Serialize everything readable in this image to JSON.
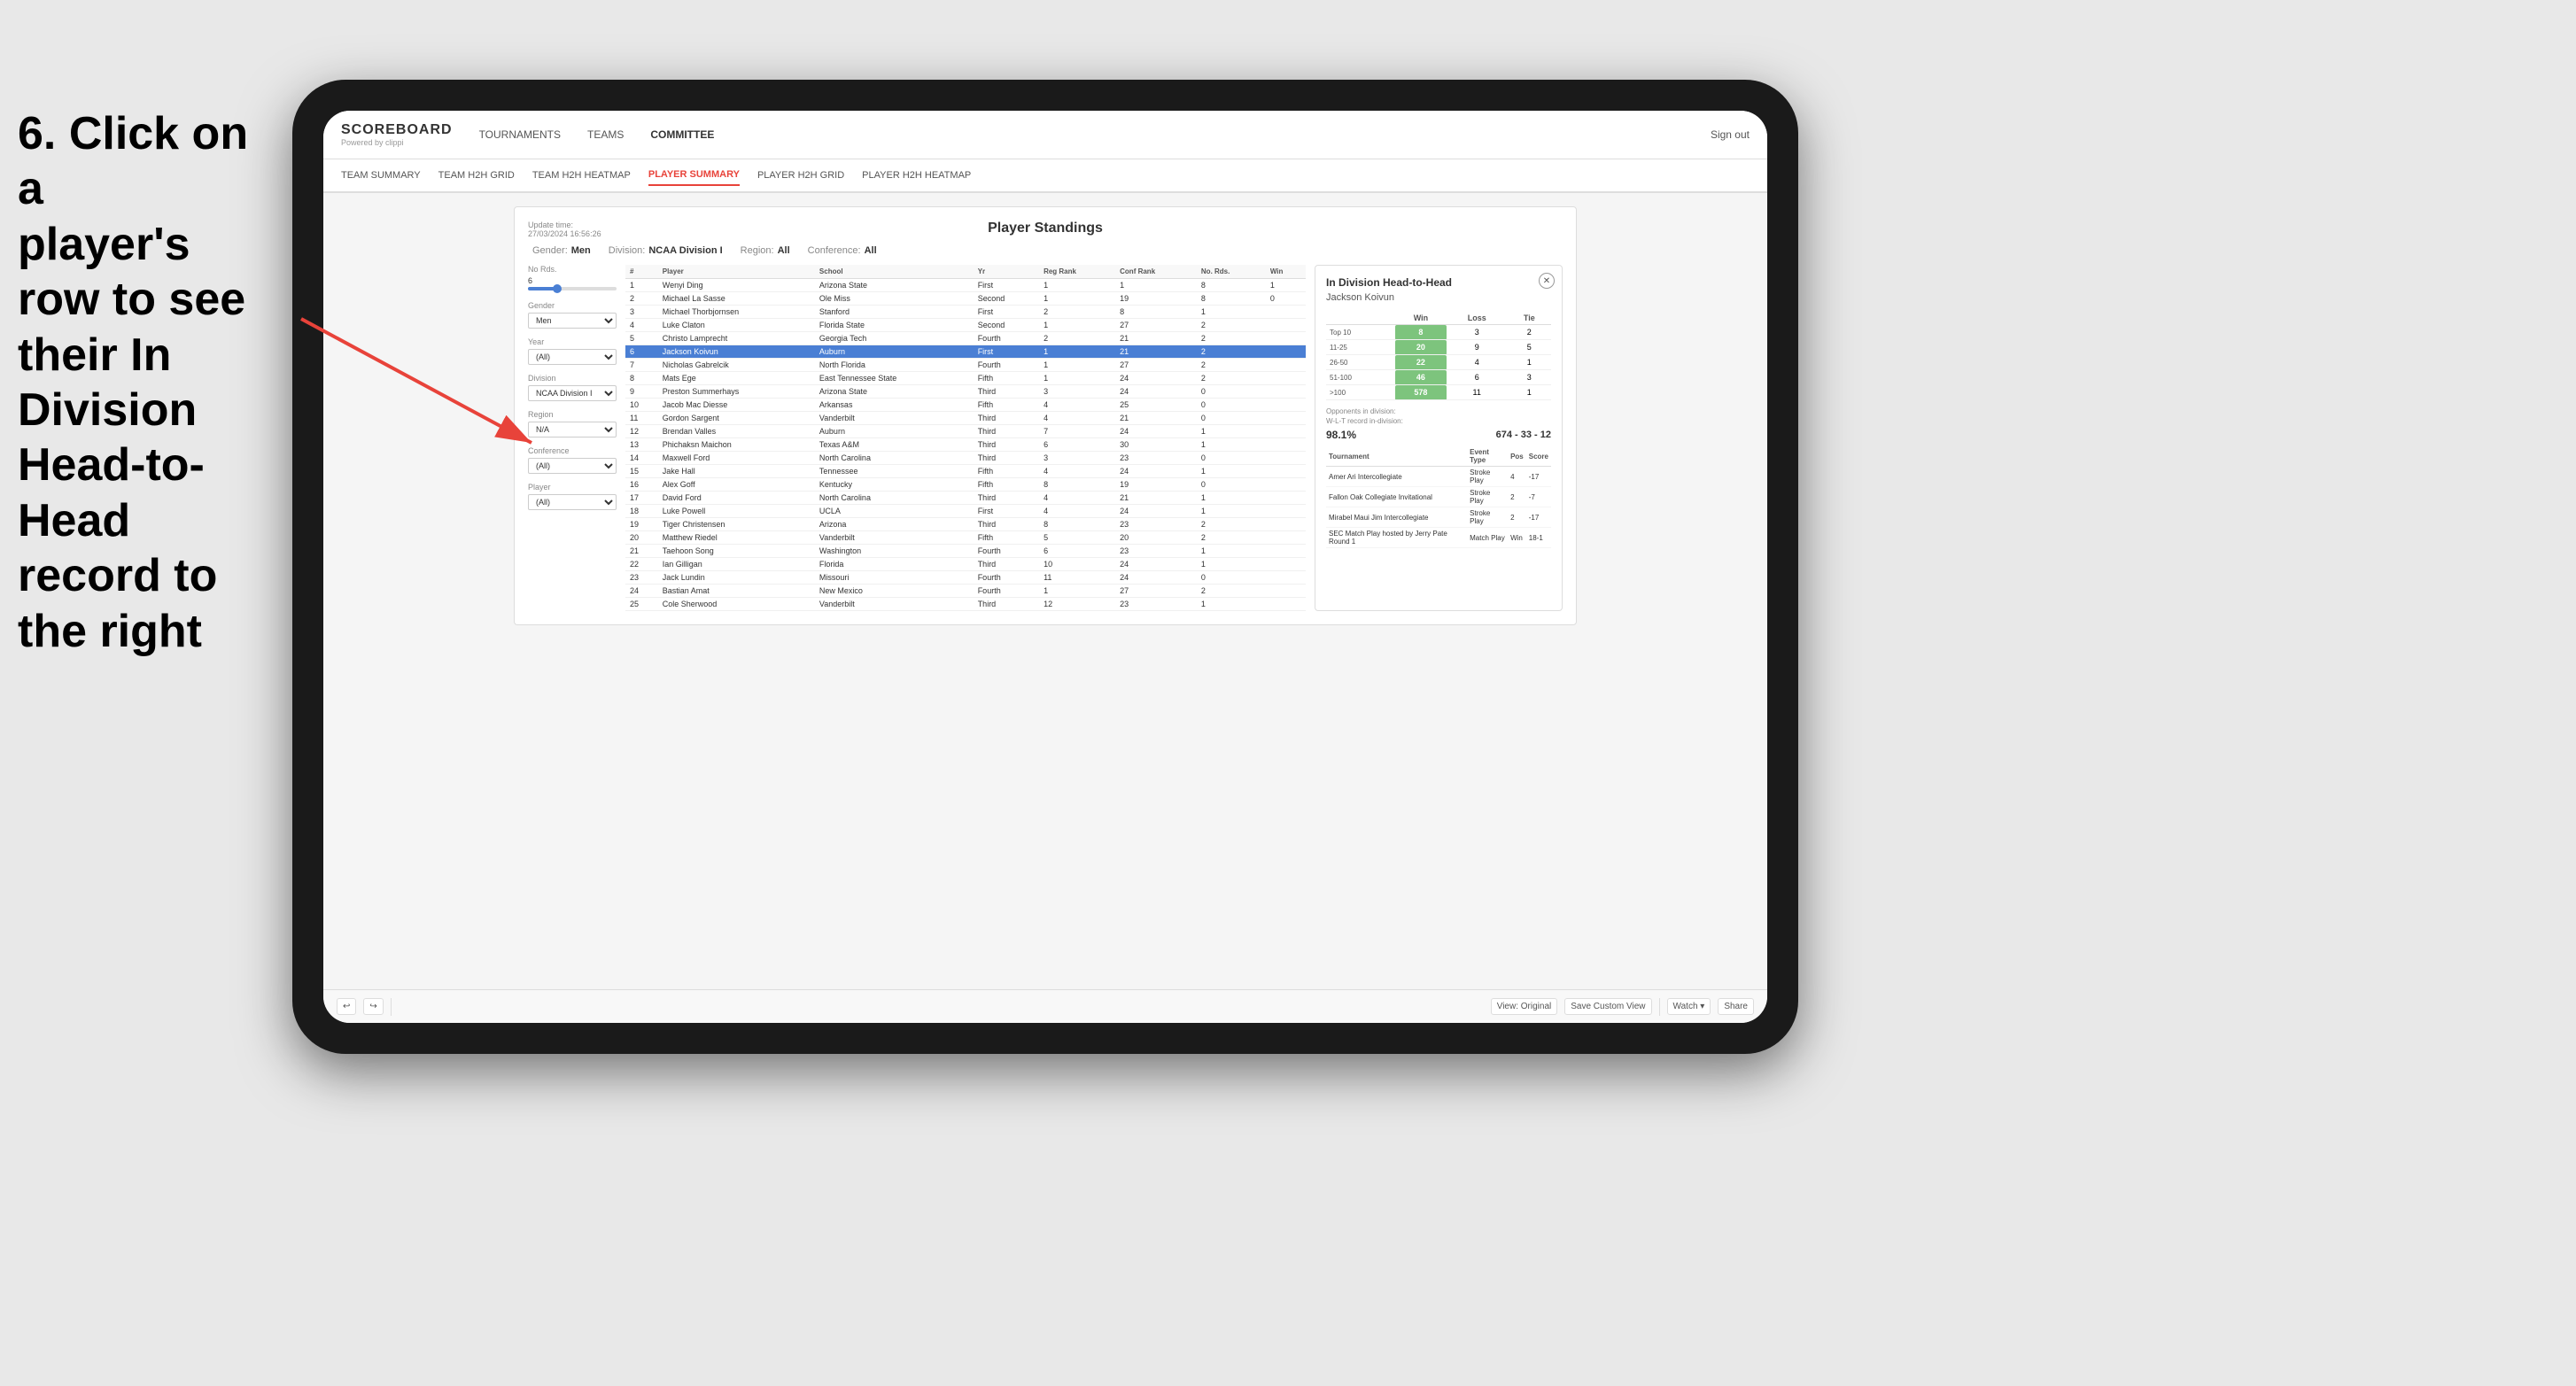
{
  "instruction": {
    "lines": [
      "6. Click on a",
      "player's row to see",
      "their In Division",
      "Head-to-Head",
      "record to the right"
    ]
  },
  "nav": {
    "logo": "SCOREBOARD",
    "powered_by": "Powered by clippi",
    "links": [
      "TOURNAMENTS",
      "TEAMS",
      "COMMITTEE"
    ],
    "sign_out": "Sign out"
  },
  "sub_nav": {
    "links": [
      "TEAM SUMMARY",
      "TEAM H2H GRID",
      "TEAM H2H HEATMAP",
      "PLAYER SUMMARY",
      "PLAYER H2H GRID",
      "PLAYER H2H HEATMAP"
    ],
    "active": "PLAYER SUMMARY"
  },
  "card": {
    "title": "Player Standings",
    "update_time": "Update time:",
    "update_date": "27/03/2024 16:56:26"
  },
  "filters": {
    "gender_label": "Gender:",
    "gender_value": "Men",
    "division_label": "Division:",
    "division_value": "NCAA Division I",
    "region_label": "Region:",
    "region_value": "All",
    "conference_label": "Conference:",
    "conference_value": "All"
  },
  "sidebar": {
    "no_rds_label": "No Rds.",
    "no_rds_value": "6",
    "gender_label": "Gender",
    "gender_option": "Men",
    "year_label": "Year",
    "year_option": "(All)",
    "division_label": "Division",
    "division_option": "NCAA Division I",
    "region_label": "Region",
    "region_option": "N/A",
    "conference_label": "Conference",
    "conference_option": "(All)",
    "player_label": "Player",
    "player_option": "(All)"
  },
  "table": {
    "headers": [
      "#",
      "Player",
      "School",
      "Yr",
      "Reg Rank",
      "Conf Rank",
      "No. Rds.",
      "Win"
    ],
    "rows": [
      {
        "num": 1,
        "player": "Wenyi Ding",
        "school": "Arizona State",
        "yr": "First",
        "reg": 1,
        "conf": 1,
        "rds": 8,
        "win": 1
      },
      {
        "num": 2,
        "player": "Michael La Sasse",
        "school": "Ole Miss",
        "yr": "Second",
        "reg": 1,
        "conf": 19,
        "rds": 8,
        "win": 0
      },
      {
        "num": 3,
        "player": "Michael Thorbjornsen",
        "school": "Stanford",
        "yr": "First",
        "reg": 2,
        "conf": 8,
        "rds": 1
      },
      {
        "num": 4,
        "player": "Luke Claton",
        "school": "Florida State",
        "yr": "Second",
        "reg": 1,
        "conf": 27,
        "rds": 2
      },
      {
        "num": 5,
        "player": "Christo Lamprecht",
        "school": "Georgia Tech",
        "yr": "Fourth",
        "reg": 2,
        "conf": 21,
        "rds": 2
      },
      {
        "num": 6,
        "player": "Jackson Koivun",
        "school": "Auburn",
        "yr": "First",
        "reg": 1,
        "conf": 21,
        "rds": 2,
        "highlighted": true
      },
      {
        "num": 7,
        "player": "Nicholas Gabrelcik",
        "school": "North Florida",
        "yr": "Fourth",
        "reg": 1,
        "conf": 27,
        "rds": 2
      },
      {
        "num": 8,
        "player": "Mats Ege",
        "school": "East Tennessee State",
        "yr": "Fifth",
        "reg": 1,
        "conf": 24,
        "rds": 2
      },
      {
        "num": 9,
        "player": "Preston Summerhays",
        "school": "Arizona State",
        "yr": "Third",
        "reg": 3,
        "conf": 24,
        "rds": 0
      },
      {
        "num": 10,
        "player": "Jacob Mac Diesse",
        "school": "Arkansas",
        "yr": "Fifth",
        "reg": 4,
        "conf": 25,
        "rds": 0
      },
      {
        "num": 11,
        "player": "Gordon Sargent",
        "school": "Vanderbilt",
        "yr": "Third",
        "reg": 4,
        "conf": 21,
        "rds": 0
      },
      {
        "num": 12,
        "player": "Brendan Valles",
        "school": "Auburn",
        "yr": "Third",
        "reg": 7,
        "conf": 24,
        "rds": 1
      },
      {
        "num": 13,
        "player": "Phichaksn Maichon",
        "school": "Texas A&M",
        "yr": "Third",
        "reg": 6,
        "conf": 30,
        "rds": 1
      },
      {
        "num": 14,
        "player": "Maxwell Ford",
        "school": "North Carolina",
        "yr": "Third",
        "reg": 3,
        "conf": 23,
        "rds": 0
      },
      {
        "num": 15,
        "player": "Jake Hall",
        "school": "Tennessee",
        "yr": "Fifth",
        "reg": 4,
        "conf": 24,
        "rds": 1
      },
      {
        "num": 16,
        "player": "Alex Goff",
        "school": "Kentucky",
        "yr": "Fifth",
        "reg": 8,
        "conf": 19,
        "rds": 0
      },
      {
        "num": 17,
        "player": "David Ford",
        "school": "North Carolina",
        "yr": "Third",
        "reg": 4,
        "conf": 21,
        "rds": 1
      },
      {
        "num": 18,
        "player": "Luke Powell",
        "school": "UCLA",
        "yr": "First",
        "reg": 4,
        "conf": 24,
        "rds": 1
      },
      {
        "num": 19,
        "player": "Tiger Christensen",
        "school": "Arizona",
        "yr": "Third",
        "reg": 8,
        "conf": 23,
        "rds": 2
      },
      {
        "num": 20,
        "player": "Matthew Riedel",
        "school": "Vanderbilt",
        "yr": "Fifth",
        "reg": 5,
        "conf": 20,
        "rds": 2
      },
      {
        "num": 21,
        "player": "Taehoon Song",
        "school": "Washington",
        "yr": "Fourth",
        "reg": 6,
        "conf": 23,
        "rds": 1
      },
      {
        "num": 22,
        "player": "Ian Gilligan",
        "school": "Florida",
        "yr": "Third",
        "reg": 10,
        "conf": 24,
        "rds": 1
      },
      {
        "num": 23,
        "player": "Jack Lundin",
        "school": "Missouri",
        "yr": "Fourth",
        "reg": 11,
        "conf": 24,
        "rds": 0
      },
      {
        "num": 24,
        "player": "Bastian Amat",
        "school": "New Mexico",
        "yr": "Fourth",
        "reg": 1,
        "conf": 27,
        "rds": 2
      },
      {
        "num": 25,
        "player": "Cole Sherwood",
        "school": "Vanderbilt",
        "yr": "Third",
        "reg": 12,
        "conf": 23,
        "rds": 1
      }
    ]
  },
  "h2h": {
    "title": "In Division Head-to-Head",
    "player_name": "Jackson Koivun",
    "col_win": "Win",
    "col_loss": "Loss",
    "col_tie": "Tie",
    "rows": [
      {
        "label": "Top 10",
        "win": 8,
        "loss": 3,
        "tie": 2,
        "win_class": "win-cell"
      },
      {
        "label": "11-25",
        "win": 20,
        "loss": 9,
        "tie": 5,
        "win_class": "win-cell"
      },
      {
        "label": "26-50",
        "win": 22,
        "loss": 4,
        "tie": 1,
        "win_class": "win-cell"
      },
      {
        "label": "51-100",
        "win": 46,
        "loss": 6,
        "tie": 3,
        "win_class": "win-cell"
      },
      {
        "label": ">100",
        "win": 578,
        "loss": 11,
        "tie": 1,
        "win_class": "win-cell"
      }
    ],
    "opponents_label": "Opponents in division:",
    "wl_label": "W-L-T record in-division:",
    "opponents_pct": "98.1%",
    "wl_record": "674 - 33 - 12",
    "tournaments": [
      {
        "name": "Amer Ari Intercollegiate",
        "type": "Stroke Play",
        "pos": 4,
        "score": "-17"
      },
      {
        "name": "Fallon Oak Collegiate Invitational",
        "type": "Stroke Play",
        "pos": 2,
        "score": "-7"
      },
      {
        "name": "Mirabel Maui Jim Intercollegiate",
        "type": "Stroke Play",
        "pos": 2,
        "score": "-17"
      },
      {
        "name": "SEC Match Play hosted by Jerry Pate Round 1",
        "type": "Match Play",
        "pos": "Win",
        "score": "18-1"
      }
    ],
    "tournament_col_1": "Tournament",
    "tournament_col_2": "Event Type",
    "tournament_col_3": "Pos",
    "tournament_col_4": "Score"
  },
  "toolbar": {
    "undo": "↩",
    "redo": "↪",
    "view_original": "View: Original",
    "save_custom": "Save Custom View",
    "watch": "Watch ▾",
    "share": "Share"
  }
}
